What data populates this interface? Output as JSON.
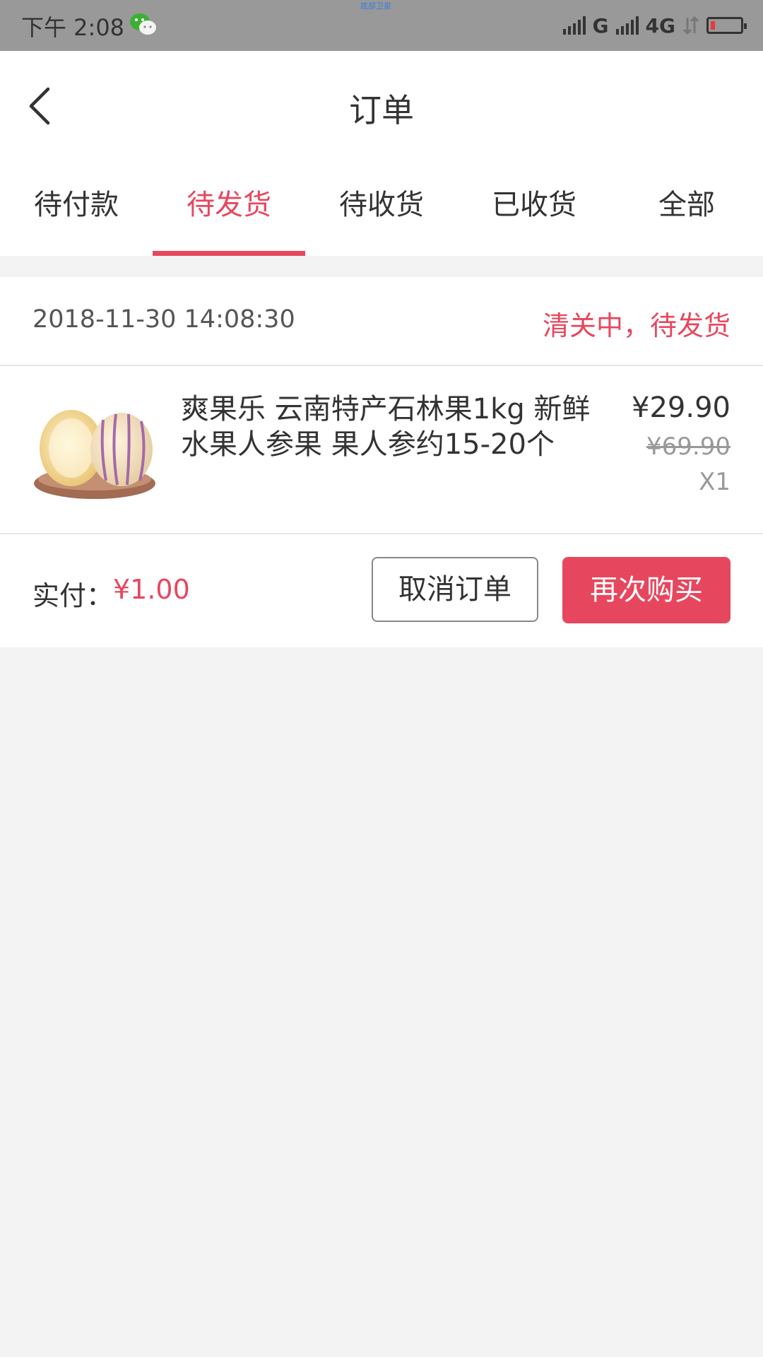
{
  "status_bar": {
    "time": "下午 2:08",
    "carrier_label": "G",
    "network_label": "4G",
    "tiny_text": "底部卫星"
  },
  "header": {
    "title": "订单"
  },
  "tabs": [
    {
      "label": "待付款",
      "active": false
    },
    {
      "label": "待发货",
      "active": true
    },
    {
      "label": "待收货",
      "active": false
    },
    {
      "label": "已收货",
      "active": false
    },
    {
      "label": "全部",
      "active": false
    }
  ],
  "order": {
    "datetime": "2018-11-30 14:08:30",
    "status": "清关中，待发货",
    "product": {
      "name": "爽果乐 云南特产石林果1kg 新鲜水果人参果 果人参约15-20个",
      "price": "¥29.90",
      "original_price": "¥69.90",
      "quantity": "X1"
    },
    "paid_label": "实付：",
    "paid_amount": "¥1.00",
    "cancel_label": "取消订单",
    "rebuy_label": "再次购买"
  },
  "colors": {
    "accent": "#e7475e",
    "status_bar": "#999999"
  }
}
